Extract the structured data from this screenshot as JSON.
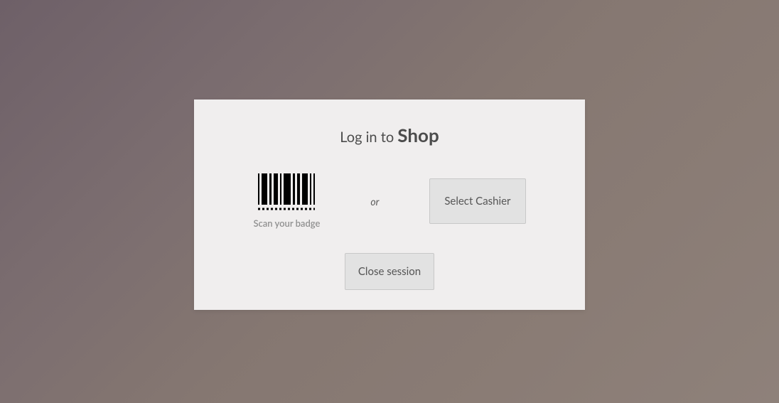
{
  "login": {
    "title_prefix": "Log in to ",
    "shop_name": "Shop",
    "badge_label": "Scan your badge",
    "or_separator": "or",
    "select_cashier_label": "Select Cashier",
    "close_session_label": "Close session"
  }
}
